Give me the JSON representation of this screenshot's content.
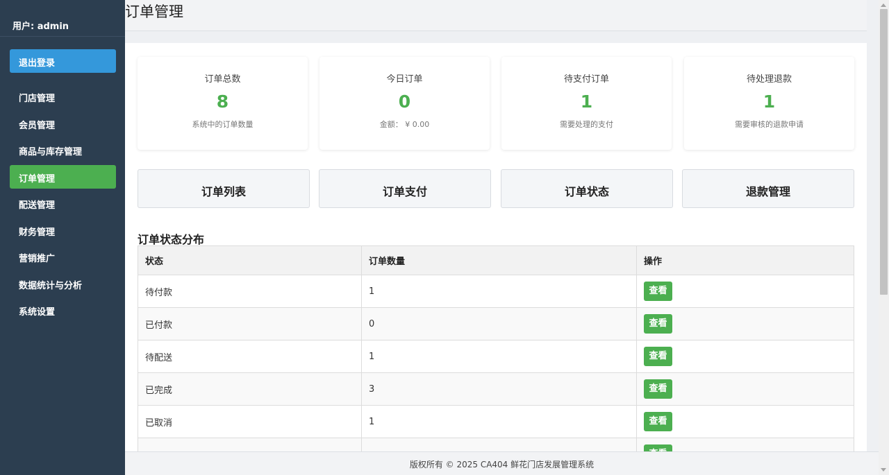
{
  "sidebar": {
    "user_label": "用户: admin",
    "logout_label": "退出登录",
    "items": [
      {
        "label": "门店管理"
      },
      {
        "label": "会员管理"
      },
      {
        "label": "商品与库存管理"
      },
      {
        "label": "订单管理",
        "active": true
      },
      {
        "label": "配送管理"
      },
      {
        "label": "财务管理"
      },
      {
        "label": "营销推广"
      },
      {
        "label": "数据统计与分析"
      },
      {
        "label": "系统设置"
      }
    ]
  },
  "header": {
    "title": "订单管理"
  },
  "stats": [
    {
      "label": "订单总数",
      "value": "8",
      "sub": "系统中的订单数量"
    },
    {
      "label": "今日订单",
      "value": "0",
      "sub": "金额： ¥ 0.00"
    },
    {
      "label": "待支付订单",
      "value": "1",
      "sub": "需要处理的支付"
    },
    {
      "label": "待处理退款",
      "value": "1",
      "sub": "需要审核的退款申请"
    }
  ],
  "actions": [
    {
      "label": "订单列表"
    },
    {
      "label": "订单支付"
    },
    {
      "label": "订单状态"
    },
    {
      "label": "退款管理"
    }
  ],
  "status_section": {
    "title": "订单状态分布",
    "columns": [
      "状态",
      "订单数量",
      "操作"
    ],
    "rows": [
      {
        "status": "待付款",
        "count": "1",
        "action": "查看"
      },
      {
        "status": "已付款",
        "count": "0",
        "action": "查看"
      },
      {
        "status": "待配送",
        "count": "1",
        "action": "查看"
      },
      {
        "status": "已完成",
        "count": "3",
        "action": "查看"
      },
      {
        "status": "已取消",
        "count": "1",
        "action": "查看"
      },
      {
        "status": "",
        "count": "",
        "action": "查看"
      }
    ]
  },
  "footer": {
    "text": "版权所有 © 2025 CA404 鲜花门店发展管理系统"
  },
  "colors": {
    "sidebar_bg": "#2c3e50",
    "accent_blue": "#3498db",
    "accent_green": "#4caf50"
  }
}
